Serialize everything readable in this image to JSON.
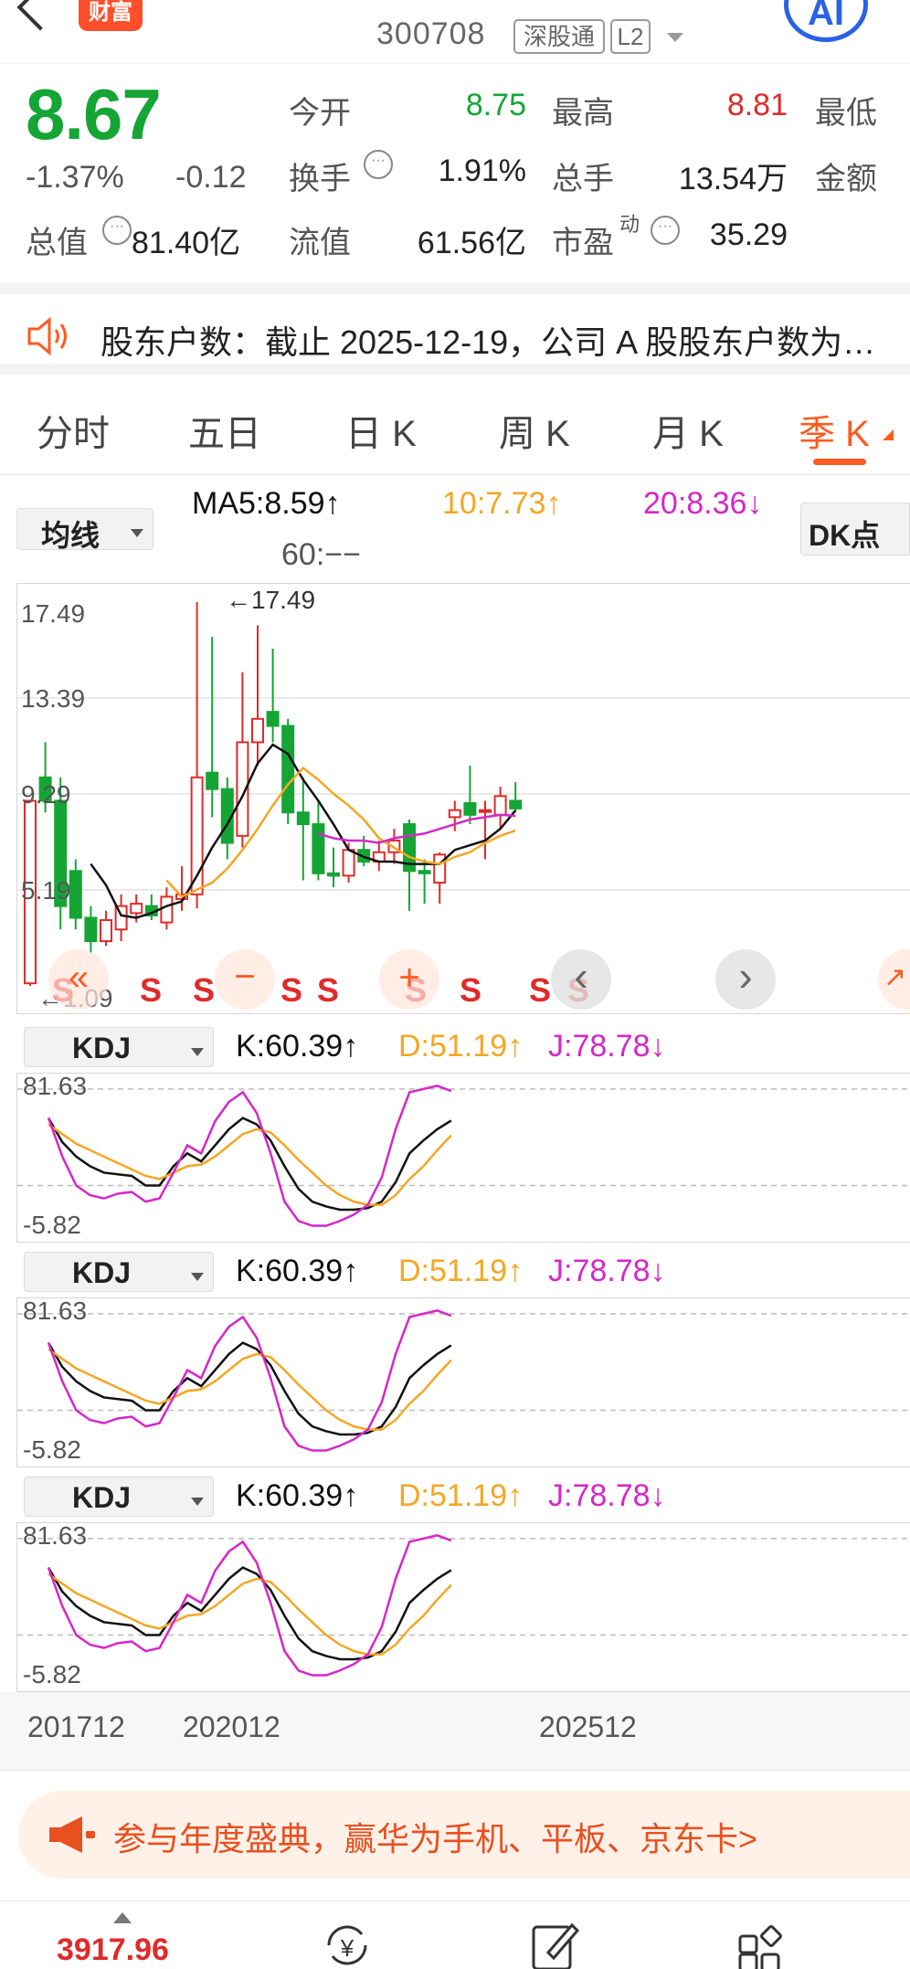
{
  "header": {
    "brand_badge": "财富",
    "stock_code": "300708",
    "tag_connect": "深股通",
    "tag_level": "L2",
    "ai_button": "AI"
  },
  "quote": {
    "price": "8.67",
    "change_pct": "-1.37%",
    "change_amt": "-0.12",
    "open_label": "今开",
    "open_value": "8.75",
    "high_label": "最高",
    "high_value": "8.81",
    "low_label": "最低",
    "turnover_label": "换手",
    "turnover_value": "1.91%",
    "volume_label": "总手",
    "volume_value": "13.54万",
    "amount_label": "金额",
    "mktcap_label": "总值",
    "mktcap_value": "81.40亿",
    "float_label": "流值",
    "float_value": "61.56亿",
    "pe_label": "市盈",
    "pe_sup": "动",
    "pe_value": "35.29"
  },
  "notice": {
    "text": "股东户数：截止 2025-12-19，公司 A 股股东户数为…"
  },
  "tabs": [
    {
      "label": "分时"
    },
    {
      "label": "五日"
    },
    {
      "label": "日 K"
    },
    {
      "label": "周 K"
    },
    {
      "label": "月 K"
    },
    {
      "label": "季 K"
    }
  ],
  "ma": {
    "selector": "均线",
    "ma5": "MA5:8.59↑",
    "ma10": "10:7.73↑",
    "ma20": "20:8.36↓",
    "ma60": "60:−−",
    "dk_button": "DK点"
  },
  "kline": {
    "y_labels": [
      "17.49",
      "13.39",
      "9.29",
      "5.19",
      "1.09"
    ],
    "max_label": "←17.49",
    "min_label": "←1.09",
    "signal_marks": [
      "S",
      "S",
      "S",
      "S",
      "S",
      "S",
      "S",
      "S",
      "S"
    ],
    "nav_prev": "‹",
    "nav_next": "›"
  },
  "kdj_panels": [
    {
      "selector": "KDJ",
      "k": "K:60.39↑",
      "d": "D:51.19↑",
      "j": "J:78.78↓",
      "y_top": "81.63",
      "y_bottom": "-5.82"
    },
    {
      "selector": "KDJ",
      "k": "K:60.39↑",
      "d": "D:51.19↑",
      "j": "J:78.78↓",
      "y_top": "81.63",
      "y_bottom": "-5.82"
    },
    {
      "selector": "KDJ",
      "k": "K:60.39↑",
      "d": "D:51.19↑",
      "j": "J:78.78↓",
      "y_top": "81.63",
      "y_bottom": "-5.82"
    }
  ],
  "x_axis": [
    "201712",
    "202012",
    "202512"
  ],
  "promo": {
    "text": "参与年度盛典，赢华为手机、平板、京东卡>"
  },
  "bottom_bar": {
    "index_value": "3917.96"
  },
  "colors": {
    "up": "#e02a2a",
    "down": "#14a535",
    "ma5": "#111111",
    "ma10": "#f5a623",
    "ma20": "#d627c8",
    "accent": "#ff5a1f"
  },
  "icons": [
    "back-icon",
    "speaker-icon",
    "info-icon",
    "yuan-cycle-icon",
    "edit-icon",
    "grid-icon"
  ],
  "chart_data": [
    {
      "type": "candlestick",
      "title": "",
      "ylim": [
        1.09,
        17.49
      ],
      "candles": [
        {
          "o": 1.2,
          "h": 9.0,
          "l": 1.09,
          "c": 9.0
        },
        {
          "o": 10.0,
          "h": 11.5,
          "l": 8.5,
          "c": 9.0
        },
        {
          "o": 9.0,
          "h": 10.0,
          "l": 3.5,
          "c": 4.5
        },
        {
          "o": 6.0,
          "h": 6.5,
          "l": 3.5,
          "c": 4.0
        },
        {
          "o": 4.0,
          "h": 4.5,
          "l": 2.5,
          "c": 3.0
        },
        {
          "o": 3.0,
          "h": 4.3,
          "l": 2.8,
          "c": 3.9
        },
        {
          "o": 3.5,
          "h": 5.0,
          "l": 3.0,
          "c": 4.5
        },
        {
          "o": 4.2,
          "h": 5.0,
          "l": 3.8,
          "c": 4.6
        },
        {
          "o": 4.5,
          "h": 5.0,
          "l": 3.9,
          "c": 4.1
        },
        {
          "o": 3.8,
          "h": 5.3,
          "l": 3.5,
          "c": 4.9
        },
        {
          "o": 4.8,
          "h": 6.2,
          "l": 4.3,
          "c": 5.0
        },
        {
          "o": 5.0,
          "h": 17.49,
          "l": 4.4,
          "c": 10.0
        },
        {
          "o": 10.2,
          "h": 16.0,
          "l": 8.3,
          "c": 9.5
        },
        {
          "o": 9.5,
          "h": 10.0,
          "l": 6.5,
          "c": 7.2
        },
        {
          "o": 7.5,
          "h": 14.5,
          "l": 7.0,
          "c": 11.5
        },
        {
          "o": 11.5,
          "h": 16.5,
          "l": 10.5,
          "c": 12.5
        },
        {
          "o": 12.8,
          "h": 15.5,
          "l": 11.5,
          "c": 12.2
        },
        {
          "o": 12.2,
          "h": 12.5,
          "l": 8.0,
          "c": 8.5
        },
        {
          "o": 8.5,
          "h": 10.0,
          "l": 5.6,
          "c": 8.0
        },
        {
          "o": 8.0,
          "h": 9.0,
          "l": 5.6,
          "c": 5.9
        },
        {
          "o": 5.9,
          "h": 7.0,
          "l": 5.3,
          "c": 5.8
        },
        {
          "o": 5.8,
          "h": 7.2,
          "l": 5.5,
          "c": 6.9
        },
        {
          "o": 6.9,
          "h": 7.5,
          "l": 6.2,
          "c": 6.4
        },
        {
          "o": 6.4,
          "h": 7.3,
          "l": 6.0,
          "c": 6.8
        },
        {
          "o": 6.8,
          "h": 7.8,
          "l": 6.3,
          "c": 7.3
        },
        {
          "o": 8.0,
          "h": 8.2,
          "l": 4.3,
          "c": 6.0
        },
        {
          "o": 6.0,
          "h": 6.5,
          "l": 4.6,
          "c": 5.9
        },
        {
          "o": 5.5,
          "h": 6.8,
          "l": 4.6,
          "c": 6.7
        },
        {
          "o": 8.3,
          "h": 9.0,
          "l": 7.7,
          "c": 8.6
        },
        {
          "o": 8.9,
          "h": 10.5,
          "l": 8.0,
          "c": 8.4
        },
        {
          "o": 8.6,
          "h": 9.0,
          "l": 6.5,
          "c": 8.6
        },
        {
          "o": 8.4,
          "h": 9.6,
          "l": 7.8,
          "c": 9.2
        },
        {
          "o": 9.0,
          "h": 9.8,
          "l": 8.5,
          "c": 8.67
        }
      ],
      "ma5": [
        null,
        null,
        null,
        null,
        6.3,
        5.4,
        4.1,
        4.0,
        4.2,
        4.5,
        4.7,
        5.8,
        7.0,
        8.0,
        9.2,
        10.6,
        11.4,
        11.0,
        9.9,
        9.0,
        8.0,
        6.9,
        6.6,
        6.4,
        6.4,
        6.3,
        6.3,
        6.3,
        6.9,
        7.1,
        7.3,
        7.8,
        8.59
      ],
      "ma10": [
        null,
        null,
        null,
        null,
        null,
        null,
        null,
        null,
        null,
        5.6,
        4.9,
        5.2,
        5.5,
        6.1,
        6.9,
        7.8,
        8.8,
        9.7,
        10.4,
        9.9,
        9.3,
        8.8,
        8.2,
        7.4,
        7.0,
        6.6,
        6.4,
        6.3,
        6.6,
        6.8,
        7.2,
        7.5,
        7.73
      ],
      "ma20": [
        null,
        null,
        null,
        null,
        null,
        null,
        null,
        null,
        null,
        null,
        null,
        null,
        null,
        null,
        null,
        null,
        null,
        null,
        null,
        7.6,
        7.4,
        7.3,
        7.3,
        7.2,
        7.4,
        7.5,
        7.6,
        7.8,
        8.0,
        8.2,
        8.3,
        8.4,
        8.36
      ]
    },
    {
      "type": "line",
      "title": "KDJ",
      "ylim": [
        -5.82,
        81.63
      ],
      "series": [
        {
          "name": "K",
          "values": [
            62,
            47,
            38,
            32,
            28,
            27,
            26,
            20,
            20,
            32,
            40,
            35,
            45,
            55,
            62,
            58,
            48,
            32,
            18,
            10,
            7,
            5,
            5,
            6,
            10,
            22,
            40,
            48,
            55,
            60.39
          ]
        },
        {
          "name": "D",
          "values": [
            58,
            52,
            46,
            42,
            38,
            34,
            30,
            26,
            24,
            28,
            32,
            33,
            38,
            45,
            52,
            55,
            53,
            45,
            36,
            28,
            20,
            14,
            10,
            8,
            8,
            14,
            24,
            32,
            42,
            51.19
          ]
        },
        {
          "name": "J",
          "values": [
            62,
            38,
            20,
            14,
            12,
            15,
            16,
            10,
            12,
            28,
            45,
            40,
            60,
            72,
            78,
            65,
            40,
            10,
            -2,
            -5,
            -5,
            -2,
            2,
            8,
            25,
            55,
            78,
            80,
            82,
            78.78
          ]
        }
      ]
    }
  ]
}
